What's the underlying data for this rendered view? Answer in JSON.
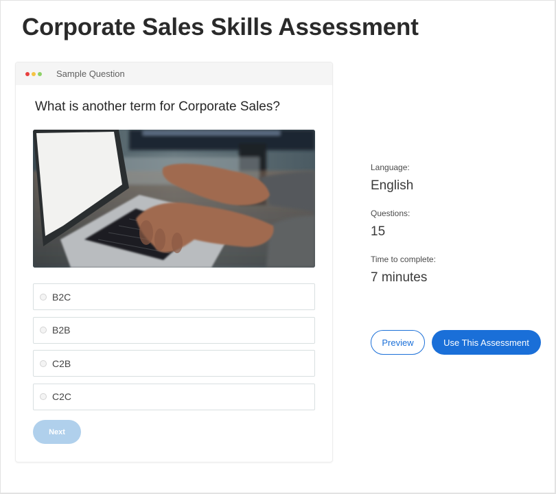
{
  "page": {
    "title": "Corporate Sales Skills Assessment"
  },
  "card": {
    "header_title": "Sample Question",
    "window_dots": [
      "#e8403f",
      "#f5c343",
      "#8ed168"
    ],
    "question": "What is another term for Corporate Sales?",
    "image_description": "laptop-typing-photo",
    "options": [
      {
        "label": "B2C",
        "selected": false
      },
      {
        "label": "B2B",
        "selected": false
      },
      {
        "label": "C2B",
        "selected": false
      },
      {
        "label": "C2C",
        "selected": false
      }
    ],
    "next_label": "Next"
  },
  "info": {
    "items": [
      {
        "label": "Language:",
        "value": "English"
      },
      {
        "label": "Questions:",
        "value": "15"
      },
      {
        "label": "Time to complete:",
        "value": "7 minutes"
      }
    ]
  },
  "actions": {
    "preview_label": "Preview",
    "use_label": "Use This Assessment"
  },
  "colors": {
    "accent": "#1a6fd8",
    "next_disabled": "#b0d0ec"
  }
}
